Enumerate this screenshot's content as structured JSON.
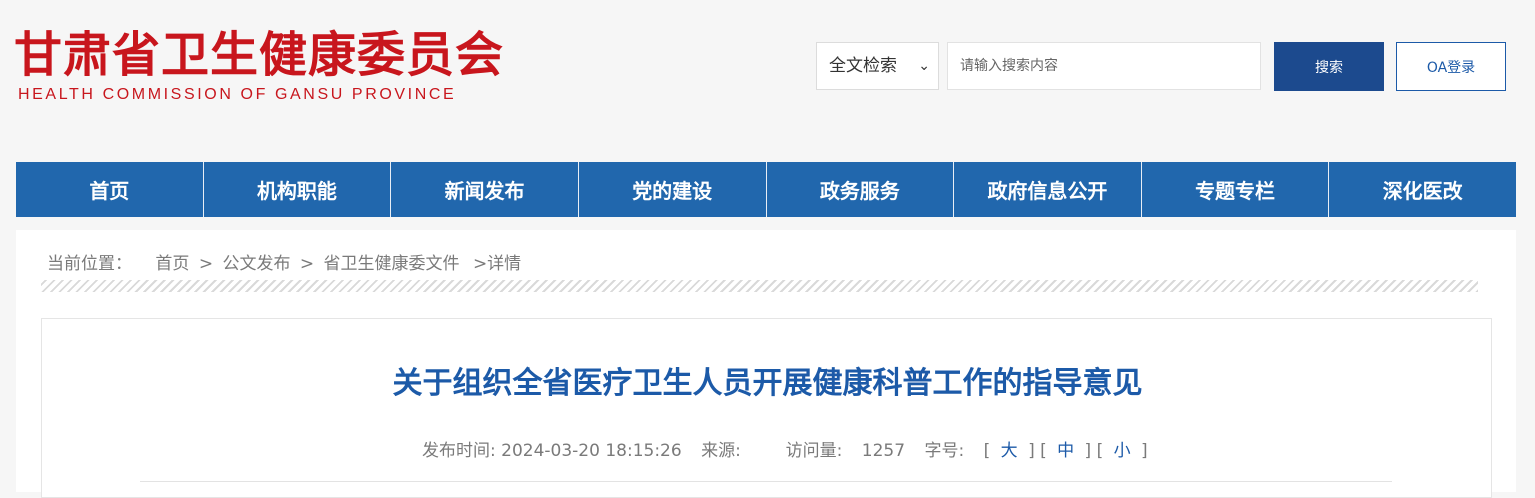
{
  "header": {
    "logo_cn": "甘肃省卫生健康委员会",
    "logo_en": "HEALTH  COMMISSION  OF  GANSU PROVINCE",
    "search_scope": "全文检索",
    "search_placeholder": "请输入搜索内容",
    "search_button": "搜索",
    "oa_button": "OA登录"
  },
  "nav": {
    "items": [
      "首页",
      "机构职能",
      "新闻发布",
      "党的建设",
      "政务服务",
      "政府信息公开",
      "专题专栏",
      "深化医改"
    ]
  },
  "breadcrumb": {
    "label": "当前位置：",
    "home": "首页",
    "sep": ">",
    "level1": "公文发布",
    "level2": "省卫生健康委文件",
    "current": ">详情"
  },
  "article": {
    "title": "关于组织全省医疗卫生人员开展健康科普工作的指导意见",
    "published_label": "发布时间:",
    "published_value": "2024-03-20 18:15:26",
    "source_label": "来源:",
    "source_value": "",
    "views_label": "访问量:",
    "views_value": "1257",
    "fontsize_label": "字号:",
    "size_large": "大",
    "size_medium": "中",
    "size_small": "小"
  },
  "colors": {
    "brand_red": "#c8161d",
    "nav_blue": "#2167ad",
    "button_blue": "#1c4a8e",
    "title_blue": "#1c5aa8"
  }
}
